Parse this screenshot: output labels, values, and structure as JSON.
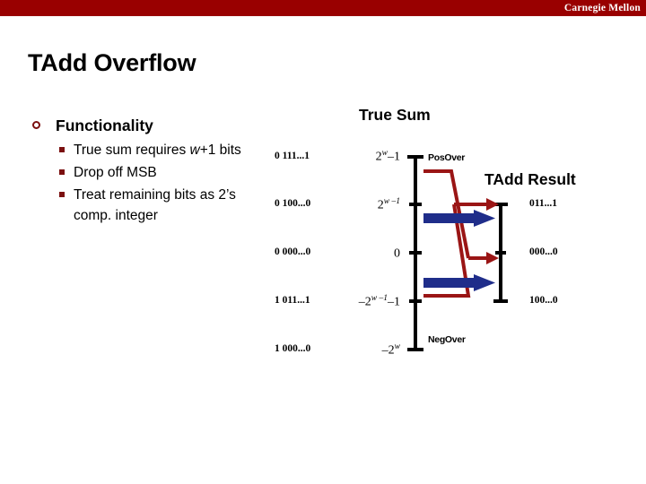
{
  "header": {
    "brand": "Carnegie Mellon",
    "band_color": "#990000"
  },
  "slide": {
    "title": "TAdd Overflow"
  },
  "bullets": {
    "level1": "Functionality",
    "items": [
      "True sum requires w+1 bits",
      "Drop off MSB",
      "Treat remaining bits as 2’s comp. integer"
    ],
    "item1_pre": "True sum requires ",
    "item1_var": "w",
    "item1_post": "+1 bits",
    "item2": "Drop off MSB",
    "item3": "Treat remaining bits as 2’s comp. integer"
  },
  "diagram": {
    "true_sum_heading": "True Sum",
    "tadd_result_heading": "TAdd Result",
    "pos_over_label": "PosOver",
    "neg_over_label": "NegOver",
    "bit_patterns": [
      "0 111...1",
      "0 100...0",
      "0 000...0",
      "1 011...1",
      "1 000...0"
    ],
    "true_sum_ticks": [
      {
        "base": "2",
        "exp": "w",
        "suffix": "–1"
      },
      {
        "base": "2",
        "exp": "w –1",
        "suffix": ""
      },
      {
        "base": "0",
        "exp": "",
        "suffix": ""
      },
      {
        "base": "–2",
        "exp": "w –1",
        "suffix": "–1"
      },
      {
        "base": "–2",
        "exp": "w",
        "suffix": ""
      }
    ],
    "result_bits": [
      "011...1",
      "000...0",
      "100...0"
    ],
    "colors": {
      "red_line": "#9A1515",
      "blue_arrow": "#1F2D8A",
      "axis": "#000000",
      "bullet": "#7B1010"
    }
  }
}
